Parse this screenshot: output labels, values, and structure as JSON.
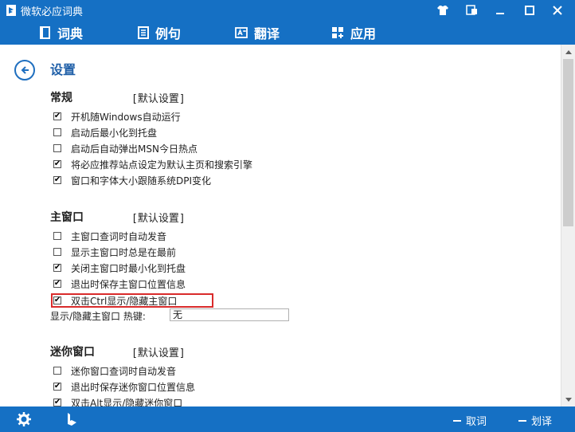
{
  "titlebar": {
    "title": "微软必应词典"
  },
  "nav": {
    "items": [
      {
        "label": "词典",
        "icon": "dictionary-book-icon"
      },
      {
        "label": "例句",
        "icon": "sentences-doc-icon"
      },
      {
        "label": "翻译",
        "icon": "translate-icon"
      },
      {
        "label": "应用",
        "icon": "apps-grid-icon"
      }
    ]
  },
  "page": {
    "title": "设置"
  },
  "sections": {
    "general": {
      "title": "常规",
      "default_label": "[默认设置]",
      "options": [
        {
          "label": "开机随Windows自动运行",
          "checked": true
        },
        {
          "label": "启动后最小化到托盘",
          "checked": false
        },
        {
          "label": "启动后自动弹出MSN今日热点",
          "checked": false
        },
        {
          "label": "将必应推荐站点设定为默认主页和搜索引擎",
          "checked": true
        },
        {
          "label": "窗口和字体大小跟随系统DPI变化",
          "checked": true
        }
      ]
    },
    "main_window": {
      "title": "主窗口",
      "default_label": "[默认设置]",
      "options": [
        {
          "label": "主窗口查词时自动发音",
          "checked": false
        },
        {
          "label": "显示主窗口时总是在最前",
          "checked": false
        },
        {
          "label": "关闭主窗口时最小化到托盘",
          "checked": true
        },
        {
          "label": "退出时保存主窗口位置信息",
          "checked": true
        },
        {
          "label": "双击Ctrl显示/隐藏主窗口",
          "checked": true
        }
      ],
      "hotkey_label": "显示/隐藏主窗口 热键:",
      "hotkey_value": "无"
    },
    "mini_window": {
      "title": "迷你窗口",
      "default_label": "[默认设置]",
      "options": [
        {
          "label": "迷你窗口查词时自动发音",
          "checked": false
        },
        {
          "label": "退出时保存迷你窗口位置信息",
          "checked": true
        },
        {
          "label": "双击Alt显示/隐藏迷你窗口",
          "checked": true
        }
      ]
    }
  },
  "bottombar": {
    "lookup_label": "取词",
    "translate_label": "划译"
  },
  "colors": {
    "brand_blue": "#1570c4",
    "highlight_red": "#d92b2b"
  }
}
